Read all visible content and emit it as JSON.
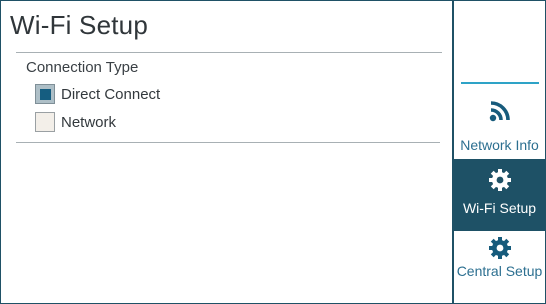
{
  "page": {
    "title": "Wi-Fi Setup"
  },
  "connection": {
    "section_label": "Connection Type",
    "options": [
      {
        "label": "Direct Connect",
        "checked": true
      },
      {
        "label": "Network",
        "checked": false
      }
    ]
  },
  "sidebar": {
    "items": [
      {
        "label": "Network Info",
        "icon": "wifi-signal-icon",
        "selected": false
      },
      {
        "label": "Wi-Fi Setup",
        "icon": "gear-icon",
        "selected": true
      },
      {
        "label": "Central Setup",
        "icon": "gear-icon",
        "selected": false
      }
    ]
  },
  "colors": {
    "accent": "#1e5166",
    "selected_check": "#155d80",
    "sidebar_text": "#2c6f90",
    "divider": "#2ea3c7"
  }
}
